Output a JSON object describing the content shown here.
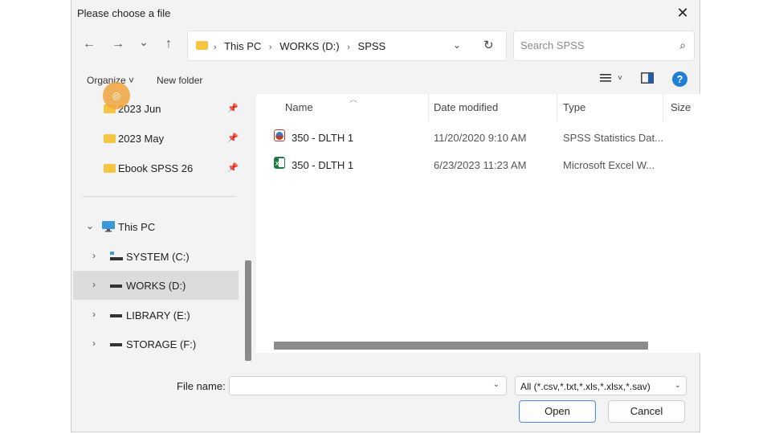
{
  "window": {
    "title": "Please choose a file",
    "close_label": "✕"
  },
  "nav": {
    "back": "←",
    "forward": "→",
    "recent": "⌄",
    "up": "↑"
  },
  "address": {
    "crumbs": [
      "This PC",
      "WORKS (D:)",
      "SPSS"
    ],
    "separator": "›"
  },
  "search": {
    "placeholder": "Search SPSS"
  },
  "toolbar": {
    "organize": "Organize ˅",
    "new_folder": "New folder",
    "view_dd": "˅",
    "help": "?"
  },
  "sidebar": {
    "quick_access": [
      {
        "label": "2023 Jun"
      },
      {
        "label": "2023 May"
      },
      {
        "label": "Ebook SPSS 26"
      }
    ],
    "this_pc": "This PC",
    "drives": [
      {
        "label": "SYSTEM (C:)"
      },
      {
        "label": "WORKS (D:)"
      },
      {
        "label": "LIBRARY (E:)"
      },
      {
        "label": "STORAGE (F:)"
      }
    ],
    "pin_glyph": "📌",
    "chevron_right": "›",
    "chevron_down": "⌄"
  },
  "columns": {
    "name": "Name",
    "date": "Date modified",
    "type": "Type",
    "size": "Size"
  },
  "files": [
    {
      "name": "350 - DLTH 1",
      "date": "11/20/2020 9:10 AM",
      "type": "SPSS Statistics Dat...",
      "icon": "spss-data-icon",
      "icon_color": "#c0392b"
    },
    {
      "name": "350 - DLTH 1",
      "date": "6/23/2023 11:23 AM",
      "type": "Microsoft Excel W...",
      "icon": "excel-icon",
      "icon_color": "#1e7b45"
    }
  ],
  "footer": {
    "file_name_label": "File name:",
    "file_name_value": "",
    "filter": "All (*.csv,*.txt,*.xls,*.xlsx,*.sav)",
    "open": "Open",
    "cancel": "Cancel"
  },
  "colors": {
    "accent": "#1f7ed6",
    "folder": "#f5c542",
    "selected_row": "#dcdcdc"
  }
}
